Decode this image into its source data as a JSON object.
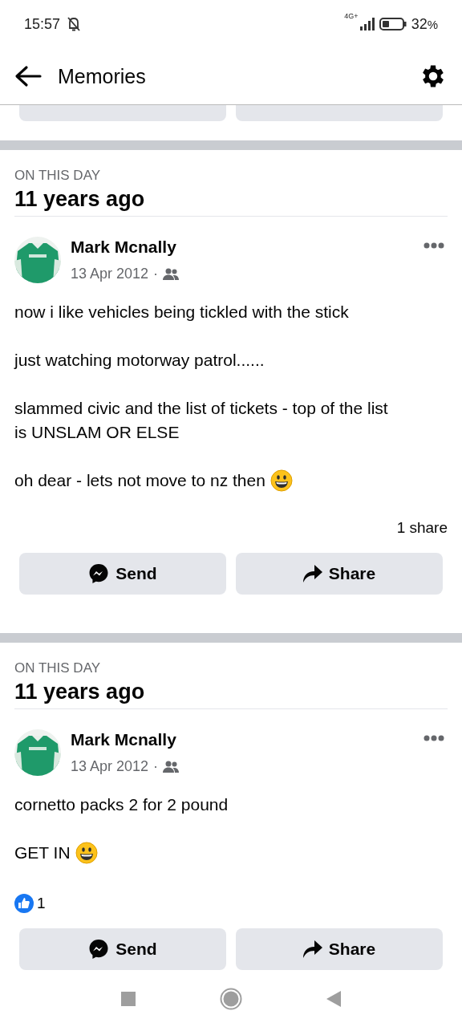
{
  "status_bar": {
    "time": "15:57",
    "network": "4G+",
    "battery": "32",
    "battery_unit": "%"
  },
  "header": {
    "title": "Memories"
  },
  "memories": [
    {
      "section": "ON THIS DAY",
      "age": "11 years ago",
      "post": {
        "author": "Mark Mcnally",
        "date": "13 Apr 2012",
        "separator": "·",
        "paragraphs": [
          {
            "lines": [
              "now i like vehicles being tickled with the stick"
            ]
          },
          {
            "lines": [
              "just watching motorway patrol......"
            ]
          },
          {
            "lines": [
              "slammed civic and the list of tickets - top of the list",
              "is UNSLAM OR ELSE"
            ]
          },
          {
            "lines": [
              "oh dear - lets not move to nz then"
            ],
            "end_icon": {
              "kind": "grin"
            }
          }
        ],
        "stats": {
          "kind": "shares",
          "text": "1 share"
        }
      },
      "actions": [
        "Send",
        "Share"
      ]
    },
    {
      "section": "ON THIS DAY",
      "age": "11 years ago",
      "post": {
        "author": "Mark Mcnally",
        "date": "13 Apr 2012",
        "separator": "·",
        "paragraphs": [
          {
            "lines": [
              "cornetto packs 2 for 2 pound"
            ]
          },
          {
            "lines": [
              "GET IN"
            ],
            "end_icon": {
              "kind": "grin"
            }
          }
        ],
        "stats": {
          "kind": "likes",
          "text": "1"
        }
      },
      "actions": [
        "Send",
        "Share"
      ]
    }
  ]
}
